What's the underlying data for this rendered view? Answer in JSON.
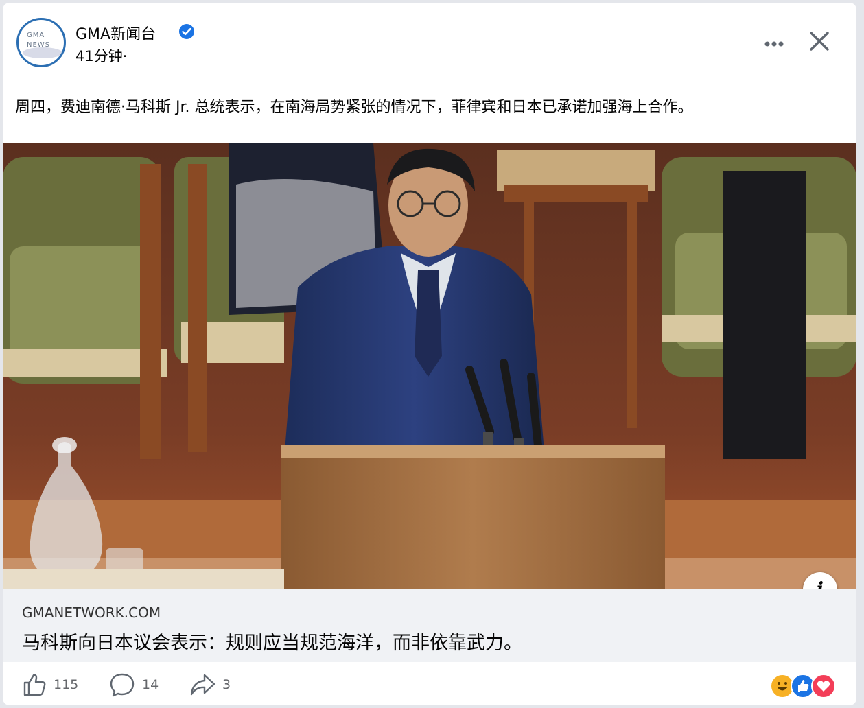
{
  "post": {
    "page_name": "GMA新闻台",
    "time": "41分钟·",
    "text": "周四，费迪南德·马科斯 Jr. 总统表示，在南海局势紧张的情况下，菲律宾和日本已承诺加强海上合作。"
  },
  "link_preview": {
    "domain": "GMANETWORK.COM",
    "title": "马科斯向日本议会表示：规则应当规范海洋，而非依靠武力。"
  },
  "actions": {
    "like_count": "115",
    "comment_count": "14",
    "share_count": "3"
  },
  "icons": {
    "verified": "verified-badge-icon",
    "more": "more-options-icon",
    "close": "close-icon",
    "info": "info-icon",
    "like": "thumbs-up-icon",
    "comment": "comment-bubble-icon",
    "share": "share-arrow-icon",
    "reactions": [
      "haha-reaction-icon",
      "like-reaction-icon",
      "love-reaction-icon"
    ]
  },
  "colors": {
    "verified_blue": "#1b74e4",
    "like_blue": "#1b74e4",
    "love_red": "#f33e58",
    "haha_yellow": "#f7b125"
  }
}
